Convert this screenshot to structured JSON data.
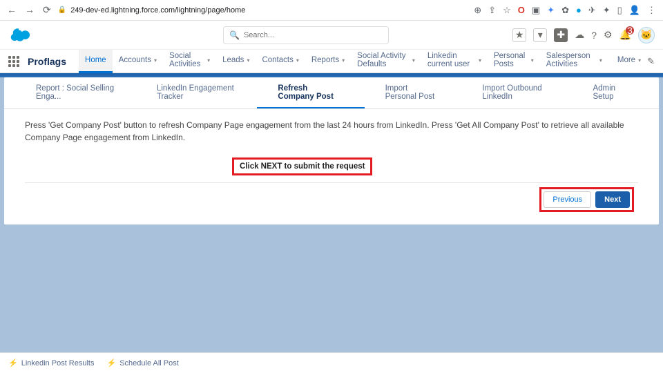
{
  "browser": {
    "url": "249-dev-ed.lightning.force.com/lightning/page/home"
  },
  "header": {
    "search_placeholder": "Search...",
    "notification_count": "3"
  },
  "nav": {
    "app_name": "Proflags",
    "items": [
      {
        "label": "Home",
        "active": true,
        "has_chev": false
      },
      {
        "label": "Accounts",
        "active": false,
        "has_chev": true
      },
      {
        "label": "Social Activities",
        "active": false,
        "has_chev": true
      },
      {
        "label": "Leads",
        "active": false,
        "has_chev": true
      },
      {
        "label": "Contacts",
        "active": false,
        "has_chev": true
      },
      {
        "label": "Reports",
        "active": false,
        "has_chev": true
      },
      {
        "label": "Social Activity Defaults",
        "active": false,
        "has_chev": true
      },
      {
        "label": "Linkedin current user",
        "active": false,
        "has_chev": true
      },
      {
        "label": "Personal Posts",
        "active": false,
        "has_chev": true
      },
      {
        "label": "Salesperson Activities",
        "active": false,
        "has_chev": true
      }
    ],
    "more_label": "More"
  },
  "tabs": [
    {
      "label": "Report : Social Selling Enga...",
      "active": false
    },
    {
      "label": "LinkedIn Engagement Tracker",
      "active": false
    },
    {
      "label": "Refresh Company Post",
      "active": true
    },
    {
      "label": "Import Personal Post",
      "active": false
    },
    {
      "label": "Import Outbound LinkedIn",
      "active": false
    },
    {
      "label": "Admin Setup",
      "active": false
    }
  ],
  "content": {
    "instruction": "Press 'Get Company Post' button to refresh Company Page engagement from the last 24 hours from LinkedIn. Press 'Get All Company Post' to retrieve all available Company Page engagement from LinkedIn.",
    "highlight_message": "Click NEXT to submit the request",
    "previous_label": "Previous",
    "next_label": "Next"
  },
  "utility": {
    "item1": "Linkedin Post Results",
    "item2": "Schedule All Post"
  }
}
